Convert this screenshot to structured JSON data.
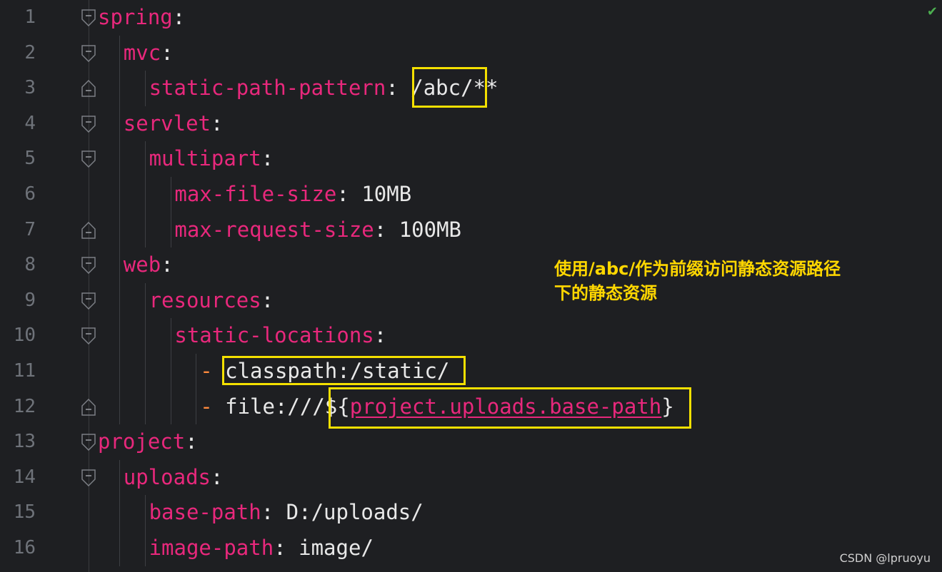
{
  "editor": {
    "status_icon": "check-icon",
    "lines": [
      {
        "num": "1",
        "indent": 0,
        "key": "spring",
        "colon": ":",
        "sep": "",
        "value": ""
      },
      {
        "num": "2",
        "indent": 1,
        "key": "mvc",
        "colon": ":",
        "sep": "",
        "value": ""
      },
      {
        "num": "3",
        "indent": 2,
        "key": "static-path-pattern",
        "colon": ":",
        "sep": " ",
        "value": "/abc/**"
      },
      {
        "num": "4",
        "indent": 1,
        "key": "servlet",
        "colon": ":",
        "sep": "",
        "value": ""
      },
      {
        "num": "5",
        "indent": 2,
        "key": "multipart",
        "colon": ":",
        "sep": "",
        "value": ""
      },
      {
        "num": "6",
        "indent": 3,
        "key": "max-file-size",
        "colon": ":",
        "sep": " ",
        "value": "10MB"
      },
      {
        "num": "7",
        "indent": 3,
        "key": "max-request-size",
        "colon": ":",
        "sep": " ",
        "value": "100MB"
      },
      {
        "num": "8",
        "indent": 1,
        "key": "web",
        "colon": ":",
        "sep": "",
        "value": ""
      },
      {
        "num": "9",
        "indent": 2,
        "key": "resources",
        "colon": ":",
        "sep": "",
        "value": ""
      },
      {
        "num": "10",
        "indent": 3,
        "key": "static-locations",
        "colon": ":",
        "sep": "",
        "value": ""
      },
      {
        "num": "11",
        "indent": 4,
        "dash": "- ",
        "value": "classpath:/static/"
      },
      {
        "num": "12",
        "indent": 4,
        "dash": "- ",
        "value": "file:///${",
        "var": "project.uploads.base-path",
        "tail": "}"
      },
      {
        "num": "13",
        "indent": 0,
        "key": "project",
        "colon": ":",
        "sep": "",
        "value": ""
      },
      {
        "num": "14",
        "indent": 1,
        "key": "uploads",
        "colon": ":",
        "sep": "",
        "value": ""
      },
      {
        "num": "15",
        "indent": 2,
        "key": "base-path",
        "colon": ":",
        "sep": " ",
        "value": "D:/uploads/"
      },
      {
        "num": "16",
        "indent": 2,
        "key": "image-path",
        "colon": ":",
        "sep": " ",
        "value": "image/"
      }
    ]
  },
  "annotation": {
    "line1": "使用/abc/作为前缀访问静态资源路径",
    "line2": "下的静态资源"
  },
  "watermark": "CSDN @lpruoyu",
  "colors": {
    "background": "#1e1f22",
    "key": "#e8287c",
    "highlight_box": "#f4e000",
    "annotation": "#ffd700"
  }
}
